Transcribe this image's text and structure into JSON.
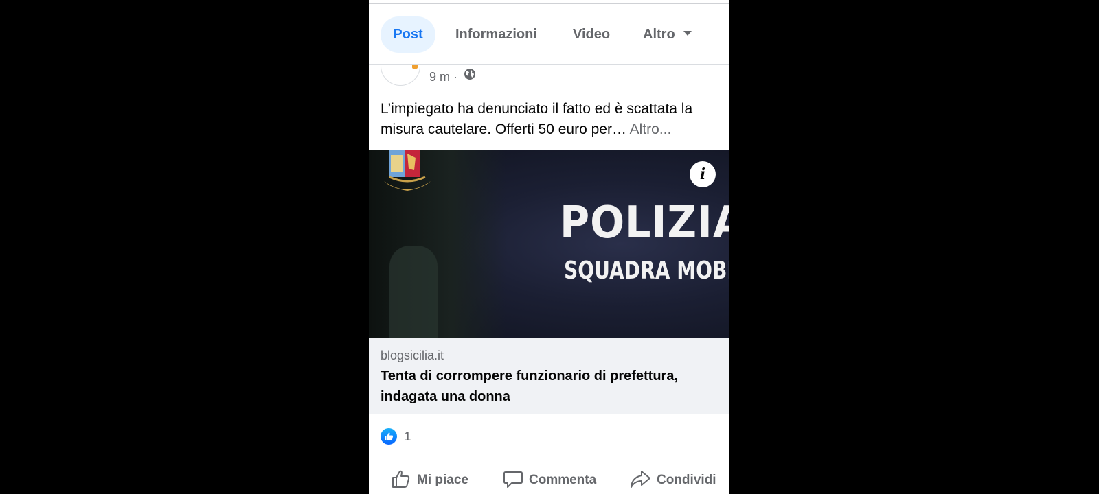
{
  "tabs": [
    {
      "label": "Post"
    },
    {
      "label": "Informazioni"
    },
    {
      "label": "Video"
    },
    {
      "label": "Altro"
    }
  ],
  "post": {
    "time": "9 m ·",
    "text": "L’impiegato ha denunciato il fatto ed è scattata la misura cautelare. Offerti 50 euro per…",
    "more": "Altro...",
    "image_text_1": "POLIZIA",
    "image_text_2": "SQUADRA MOBILE",
    "info_icon": "i"
  },
  "link": {
    "domain": "blogsicilia.it",
    "title": "Tenta di corrompere funzionario di prefettura, indagata una donna"
  },
  "reactions": {
    "count": "1"
  },
  "actions": {
    "like": "Mi piace",
    "comment": "Commenta",
    "share": "Condividi"
  },
  "colors": {
    "accent": "#1877f2",
    "tab_active_bg": "#e7f3ff",
    "secondary_text": "#65676b",
    "link_box_bg": "#f0f2f5"
  },
  "icons": [
    "globe-icon",
    "info-icon",
    "like-reaction-icon",
    "thumbs-up-icon",
    "comment-icon",
    "share-icon",
    "chevron-down-icon"
  ]
}
